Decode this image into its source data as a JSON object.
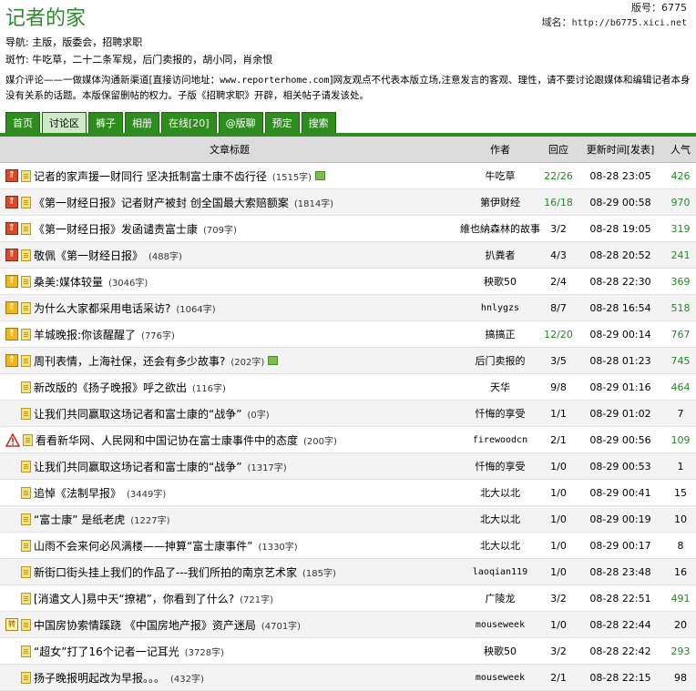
{
  "header": {
    "title": "记者的家",
    "board_no": "版号：6775",
    "domain_label": "域名：",
    "domain": "http://b6775.xici.net"
  },
  "nav": {
    "label": "导航:",
    "items": [
      "主版",
      "版委会",
      "招聘求职"
    ]
  },
  "moderators": {
    "label": "斑竹:",
    "items": [
      "牛吃草",
      "二十二条军规",
      "后门卖报的",
      "胡小同",
      "肖余恨"
    ]
  },
  "notice": {
    "text_before": "媒介评论——一做媒体沟通新渠道[直接访问地址：",
    "url": "www.reporterhome.com",
    "text_after": "]网友观点不代表本版立场,注意发言的客观、理性，请不要讨论跟媒体和编辑记者本身没有关系的话题。本版保留删帖的权力。子版《招聘求职》开辟，相关帖子请发该处。"
  },
  "tabs": [
    {
      "label": "首页",
      "active": false
    },
    {
      "label": "讨论区",
      "active": true
    },
    {
      "label": "裤子",
      "active": false
    },
    {
      "label": "相册",
      "active": false
    },
    {
      "label": "在线[20]",
      "active": false
    },
    {
      "label": "@版聊",
      "active": false
    },
    {
      "label": "预定",
      "active": false
    },
    {
      "label": "搜索",
      "active": false
    }
  ],
  "columns": {
    "title": "文章标题",
    "author": "作者",
    "reply": "回应",
    "time": "更新时间[发表]",
    "pop": "人气"
  },
  "colors": {
    "accent": "#2f8d1f",
    "highlight": "#1e8c1e"
  },
  "rows": [
    {
      "icon": "top-red-icon",
      "title": "记者的家声援一财同行 坚决抵制富士康不齿行径",
      "len": "(1515字)",
      "pic": true,
      "author": "牛吃草",
      "reply": "22/26",
      "reply_green": true,
      "time": "08-28 23:05",
      "pop": "426",
      "pop_green": true
    },
    {
      "icon": "top-red-icon",
      "title": "《第一财经日报》记者财产被封 创全国最大索赔额案",
      "len": "(1814字)",
      "pic": false,
      "author": "第伊财经",
      "reply": "16/18",
      "reply_green": true,
      "time": "08-29 00:58",
      "pop": "970",
      "pop_green": true
    },
    {
      "icon": "top-red-icon",
      "title": "《第一财经日报》发函谴责富士康",
      "len": "(709字)",
      "pic": false,
      "author": "維也納森林的故事",
      "reply": "3/2",
      "reply_green": false,
      "time": "08-28 19:05",
      "pop": "319",
      "pop_green": true
    },
    {
      "icon": "top-red-icon",
      "title": "敬佩《第一财经日报》",
      "len": "(488字)",
      "pic": false,
      "author": "扒粪者",
      "reply": "4/3",
      "reply_green": false,
      "time": "08-28 20:52",
      "pop": "241",
      "pop_green": true
    },
    {
      "icon": "top-gold-icon",
      "title": "桑美:媒体较量",
      "len": "(3046字)",
      "pic": false,
      "author": "秧歌50",
      "reply": "2/4",
      "reply_green": false,
      "time": "08-28 22:30",
      "pop": "369",
      "pop_green": true
    },
    {
      "icon": "top-gold-icon",
      "title": "为什么大家都采用电话采访?",
      "len": "(1064字)",
      "pic": false,
      "author": "hnlygzs",
      "author_mono": true,
      "reply": "8/7",
      "reply_green": false,
      "time": "08-28 16:54",
      "pop": "518",
      "pop_green": true
    },
    {
      "icon": "top-gold-icon",
      "title": "羊城晚报:你该醒醒了",
      "len": "(776字)",
      "pic": false,
      "author": "搞搞正",
      "reply": "12/20",
      "reply_green": true,
      "time": "08-29 00:14",
      "pop": "767",
      "pop_green": true
    },
    {
      "icon": "top-gold-icon",
      "title": "周刊表情，上海社保，还会有多少故事?",
      "len": "(202字)",
      "pic": true,
      "author": "后门卖报的",
      "reply": "3/5",
      "reply_green": false,
      "time": "08-28 01:23",
      "pop": "745",
      "pop_green": true
    },
    {
      "icon": "none",
      "title": "新改版的《扬子晚报》呼之欲出",
      "len": "(116字)",
      "pic": false,
      "author": "天华",
      "reply": "9/8",
      "reply_green": false,
      "time": "08-29 01:16",
      "pop": "464",
      "pop_green": true
    },
    {
      "icon": "none",
      "title": "让我们共同赢取这场记者和富士康的“战争”",
      "len": "(0字)",
      "pic": false,
      "author": "忏悔的享受",
      "reply": "1/1",
      "reply_green": false,
      "time": "08-29 01:02",
      "pop": "7",
      "pop_green": false
    },
    {
      "icon": "warning-icon",
      "title": "看看新华网、人民网和中国记协在富士康事件中的态度",
      "len": "(200字)",
      "pic": false,
      "author": "firewoodcn",
      "author_mono": true,
      "reply": "2/1",
      "reply_green": false,
      "time": "08-29 00:56",
      "pop": "109",
      "pop_green": true
    },
    {
      "icon": "none",
      "title": "让我们共同赢取这场记者和富士康的“战争”",
      "len": "(1317字)",
      "pic": false,
      "author": "忏悔的享受",
      "reply": "1/0",
      "reply_green": false,
      "time": "08-29 00:53",
      "pop": "1",
      "pop_green": false
    },
    {
      "icon": "none",
      "title": "追悼《法制早报》",
      "len": "(3449字)",
      "pic": false,
      "author": "北大以北",
      "reply": "1/0",
      "reply_green": false,
      "time": "08-29 00:41",
      "pop": "15",
      "pop_green": false
    },
    {
      "icon": "none",
      "title": "“富士康” 是纸老虎",
      "len": "(1227字)",
      "pic": false,
      "author": "北大以北",
      "reply": "1/0",
      "reply_green": false,
      "time": "08-29 00:19",
      "pop": "10",
      "pop_green": false
    },
    {
      "icon": "none",
      "title": "山雨不会来何必风满楼——抻算“富士康事件”",
      "len": "(1330字)",
      "pic": false,
      "author": "北大以北",
      "reply": "1/0",
      "reply_green": false,
      "time": "08-29 00:17",
      "pop": "8",
      "pop_green": false
    },
    {
      "icon": "none",
      "title": "新街口街头挂上我们的作品了---我们所拍的南京艺术家",
      "len": "(185字)",
      "pic": false,
      "author": "laoqian119",
      "author_mono": true,
      "reply": "1/0",
      "reply_green": false,
      "time": "08-28 23:48",
      "pop": "16",
      "pop_green": false
    },
    {
      "icon": "none",
      "title": "[消遣文人]易中天“撩裙”，你看到了什么?",
      "len": "(721字)",
      "pic": false,
      "author": "广陵龙",
      "reply": "3/2",
      "reply_green": false,
      "time": "08-28 22:51",
      "pop": "491",
      "pop_green": true
    },
    {
      "icon": "repost-icon",
      "title": "中国房协索情蹊跷 《中国房地产报》资产迷局",
      "len": "(4701字)",
      "pic": false,
      "author": "mouseweek",
      "author_mono": true,
      "reply": "1/0",
      "reply_green": false,
      "time": "08-28 22:44",
      "pop": "20",
      "pop_green": false
    },
    {
      "icon": "none",
      "title": "“超女”打了16个记者一记耳光",
      "len": "(3728字)",
      "pic": false,
      "author": "秧歌50",
      "reply": "3/2",
      "reply_green": false,
      "time": "08-28 22:42",
      "pop": "293",
      "pop_green": true
    },
    {
      "icon": "none",
      "title": "扬子晚报明起改为早报。。。",
      "len": "(432字)",
      "pic": false,
      "author": "mouseweek",
      "author_mono": true,
      "reply": "2/1",
      "reply_green": false,
      "time": "08-28 22:15",
      "pop": "98",
      "pop_green": false
    }
  ]
}
